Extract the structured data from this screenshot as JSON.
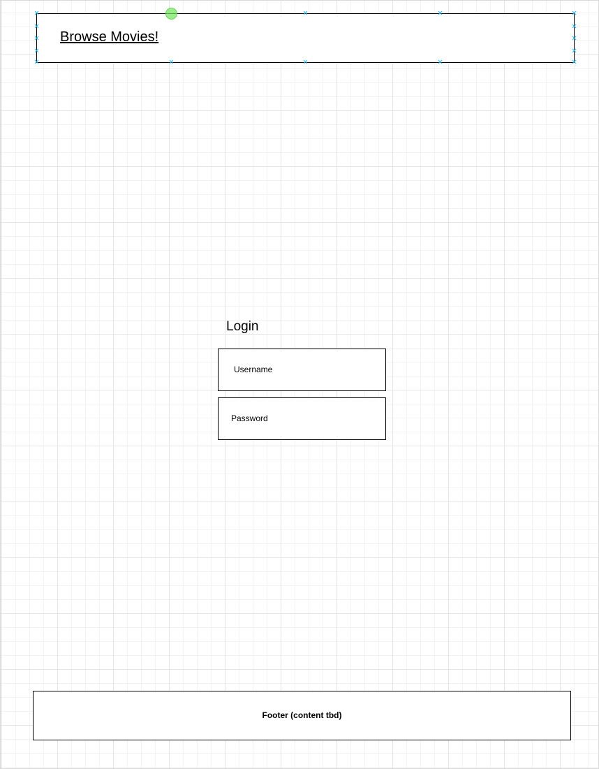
{
  "header": {
    "link_label": "Browse Movies!"
  },
  "login": {
    "title": "Login",
    "username_placeholder": "Username",
    "password_placeholder": "Password"
  },
  "footer": {
    "text": "Footer (content tbd)"
  },
  "colors": {
    "stroke": "#000000",
    "selection_handle": "#29b6f2",
    "rotation_handle": "#6ee65a",
    "grid": "#e6e6e6"
  }
}
